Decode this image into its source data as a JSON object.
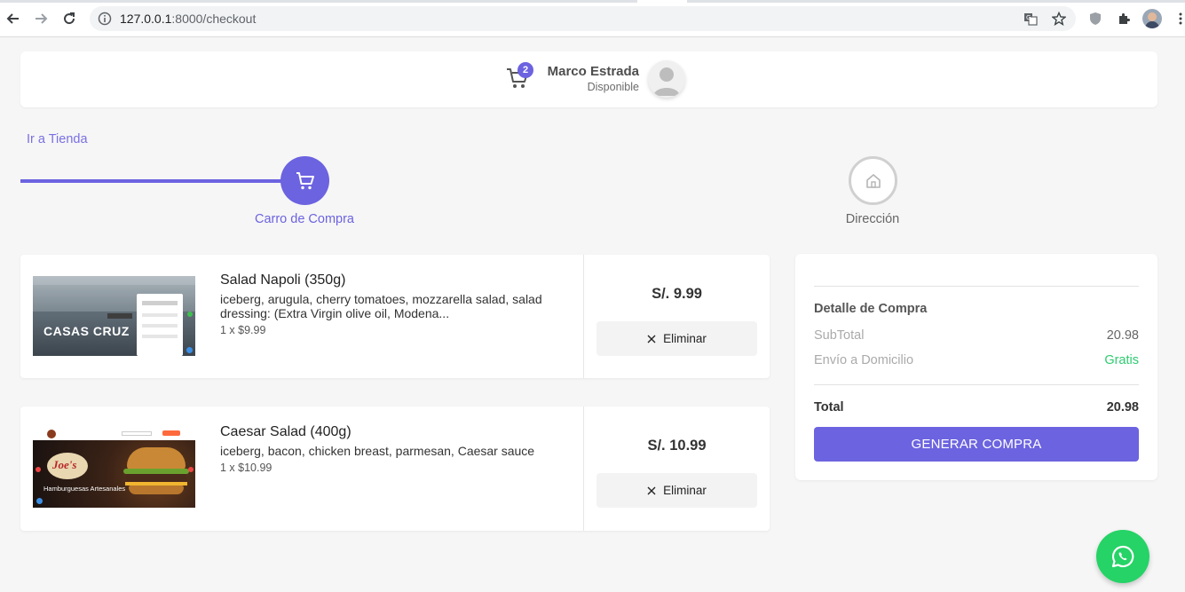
{
  "browser": {
    "url_host": "127.0.0.1",
    "url_path": ":8000/checkout"
  },
  "header": {
    "cart_count": "2",
    "user_name": "Marco Estrada",
    "user_status": "Disponible"
  },
  "store_link": "Ir a Tienda",
  "stepper": {
    "steps": [
      {
        "label": "Carro de Compra",
        "icon": "cart-icon",
        "active": true
      },
      {
        "label": "Dirección",
        "icon": "home-icon",
        "active": false
      }
    ]
  },
  "cart": {
    "items": [
      {
        "name": "Salad Napoli (350g)",
        "description": "iceberg, arugula, cherry tomatoes, mozzarella salad, salad dressing: (Extra Virgin olive oil, Modena...",
        "quantity": "1 x $9.99",
        "price": "S/. 9.99",
        "remove_label": "Eliminar",
        "thumb_text": "CASAS CRUZ"
      },
      {
        "name": "Caesar Salad (400g)",
        "description": "iceberg, bacon, chicken breast, parmesan, Caesar sauce",
        "quantity": "1 x $10.99",
        "price": "S/. 10.99",
        "remove_label": "Eliminar",
        "thumb_text": "Joe's",
        "thumb_subtext": "Hamburguesas Artesanales"
      }
    ]
  },
  "summary": {
    "title": "Detalle de Compra",
    "subtotal_label": "SubTotal",
    "subtotal_value": "20.98",
    "shipping_label": "Envío a Domicilio",
    "shipping_value": "Gratis",
    "total_label": "Total",
    "total_value": "20.98",
    "cta_label": "GENERAR COMPRA"
  },
  "colors": {
    "accent": "#6c63e0",
    "free": "#2ecc71",
    "whatsapp": "#25d366"
  }
}
